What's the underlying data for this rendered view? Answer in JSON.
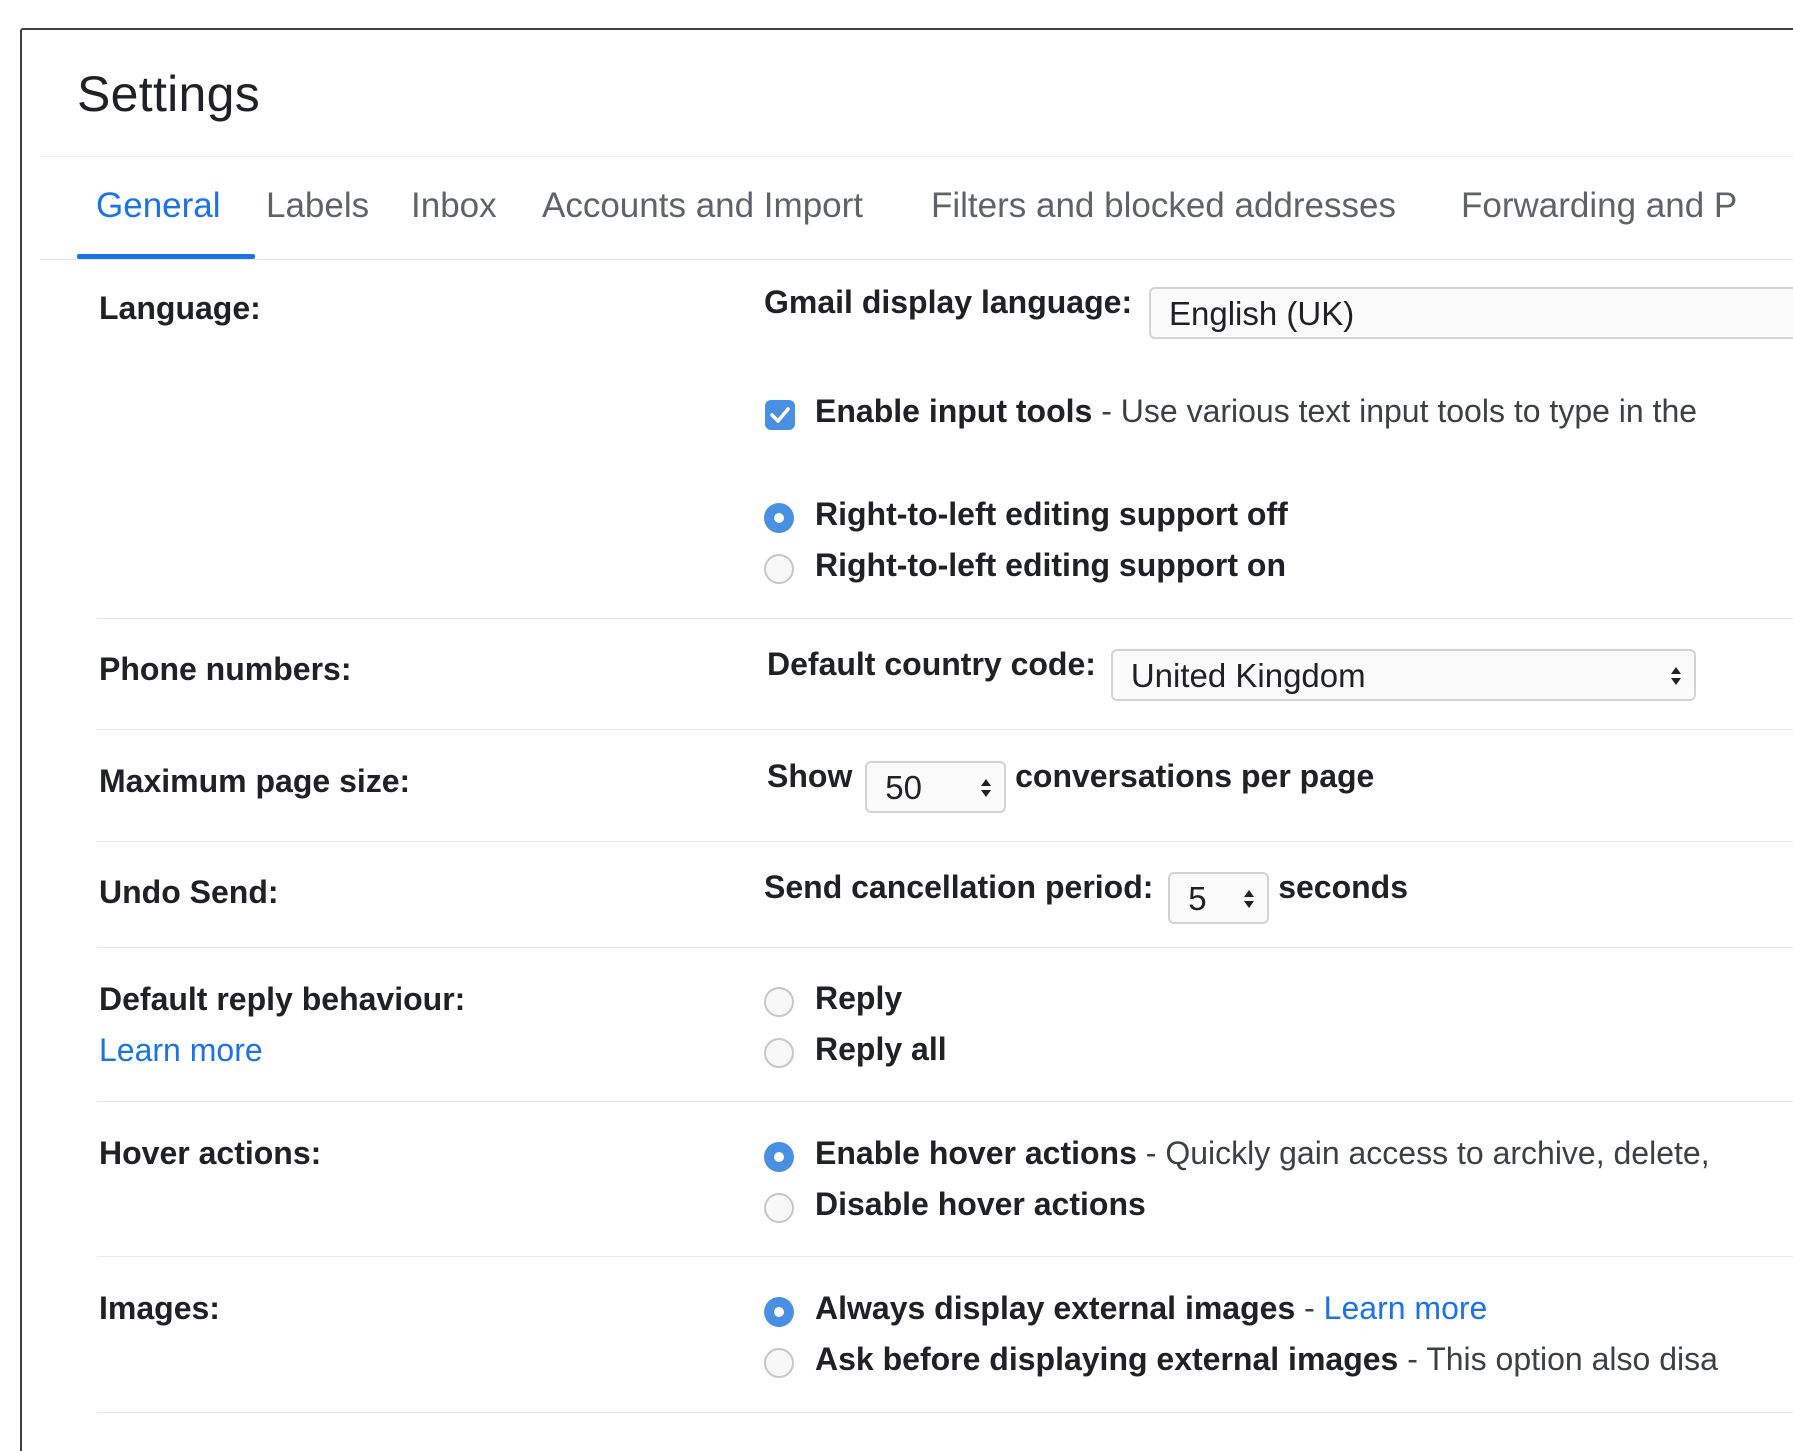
{
  "page": {
    "title": "Settings"
  },
  "tabs": [
    {
      "label": "General",
      "active": true
    },
    {
      "label": "Labels"
    },
    {
      "label": "Inbox"
    },
    {
      "label": "Accounts and Import"
    },
    {
      "label": "Filters and blocked addresses"
    },
    {
      "label": "Forwarding and P"
    }
  ],
  "language": {
    "label": "Language:",
    "display_language_label": "Gmail display language:",
    "display_language_value": "English (UK)",
    "input_tools_bold": "Enable input tools",
    "input_tools_desc": " - Use various text input tools to type in the",
    "input_tools_checked": true,
    "rtl_off": "Right-to-left editing support off",
    "rtl_on": "Right-to-left editing support on",
    "rtl_selected": "off"
  },
  "phone": {
    "label": "Phone numbers:",
    "country_code_label": "Default country code:",
    "country_code_value": "United Kingdom"
  },
  "page_size": {
    "label": "Maximum page size:",
    "show": "Show",
    "value": "50",
    "suffix": "conversations per page"
  },
  "undo_send": {
    "label": "Undo Send:",
    "period_label": "Send cancellation period:",
    "value": "5",
    "suffix": "seconds"
  },
  "reply": {
    "label": "Default reply behaviour:",
    "learn_more": "Learn more",
    "reply": "Reply",
    "reply_all": "Reply all",
    "selected": "none"
  },
  "hover": {
    "label": "Hover actions:",
    "enable_bold": "Enable hover actions",
    "enable_desc": " - Quickly gain access to archive, delete,",
    "disable": "Disable hover actions",
    "selected": "enable"
  },
  "images": {
    "label": "Images:",
    "always_bold": "Always display external images",
    "always_sep": " - ",
    "always_link": "Learn more",
    "ask_bold": "Ask before displaying external images",
    "ask_desc": " - This option also disa",
    "selected": "always"
  },
  "colors": {
    "accent": "#1a73e8",
    "control_blue": "#4a90e2",
    "text": "#202124",
    "muted": "#5f6368"
  }
}
